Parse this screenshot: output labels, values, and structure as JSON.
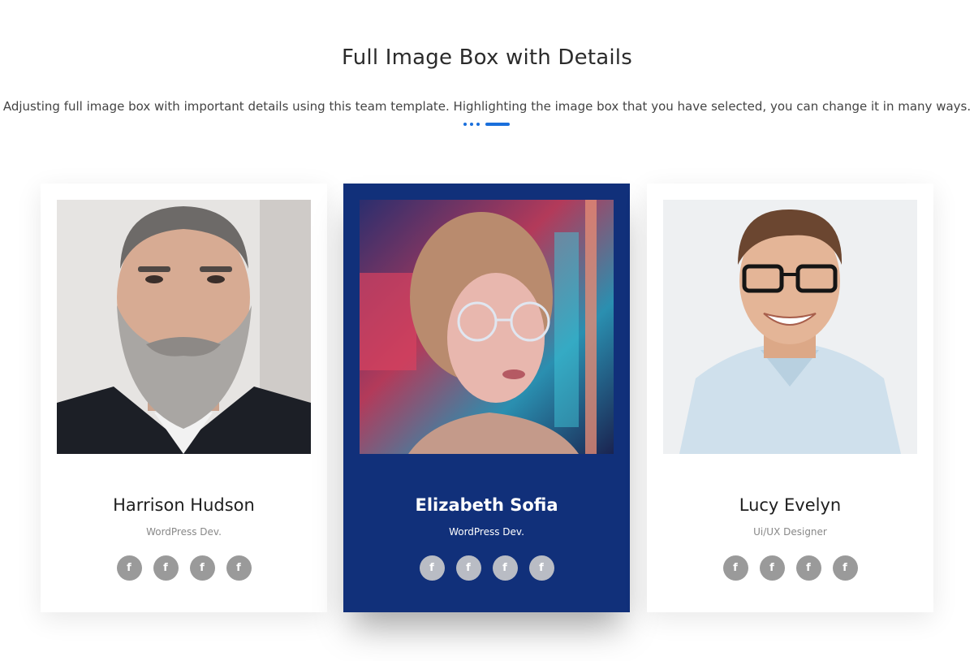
{
  "header": {
    "title": "Full Image Box with Details",
    "subtitle": "Adjusting full image box with important details using this team template. Highlighting the image box that you have selected, you can change it in many ways."
  },
  "colors": {
    "accent": "#1a6fdc",
    "active_card": "#11307a",
    "social_icon": "#9a9a9a"
  },
  "team": [
    {
      "name": "Harrison Hudson",
      "role": "WordPress Dev.",
      "socials": [
        "f",
        "f",
        "f",
        "f"
      ],
      "social_icons": [
        "facebook-icon",
        "facebook-icon",
        "facebook-icon",
        "facebook-icon"
      ],
      "active": false
    },
    {
      "name": "Elizabeth Sofia",
      "role": "WordPress Dev.",
      "socials": [
        "f",
        "f",
        "f",
        "f"
      ],
      "social_icons": [
        "facebook-icon",
        "facebook-icon",
        "facebook-icon",
        "facebook-icon"
      ],
      "active": true
    },
    {
      "name": "Lucy Evelyn",
      "role": "Ui/UX Designer",
      "socials": [
        "f",
        "f",
        "f",
        "f"
      ],
      "social_icons": [
        "facebook-icon",
        "facebook-icon",
        "facebook-icon",
        "facebook-icon"
      ],
      "active": false
    }
  ]
}
